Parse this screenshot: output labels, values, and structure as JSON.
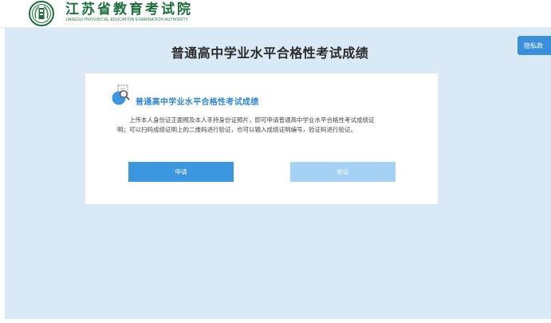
{
  "header": {
    "brand_name": "江苏省教育考试院",
    "brand_en": "JIANGSU PROVINCIAL EDUCATION EXAMINATION AUTHORITY",
    "logo_icon": "jseea-emblem-icon"
  },
  "main": {
    "title": "普通高中学业水平合格性考试成绩",
    "privacy_button": "隐私政",
    "card": {
      "icon": "certificate-search-icon",
      "title": "普通高中学业水平合格性考试成绩",
      "description": "上传本人身份证正面照及本人手持身份证照片，即可申请普通高中学业水平合格性考试成绩证明；可以扫码成绩证明上的二维码进行验证，也可以输入成绩证明编号，验证码进行验证。",
      "apply_button": "申请",
      "verify_button": "验证"
    }
  },
  "colors": {
    "brand_green": "#1b6e3a",
    "page_bg": "#d9e9f5",
    "accent_blue": "#3d97e0",
    "disabled_blue": "#a5d1f4"
  }
}
